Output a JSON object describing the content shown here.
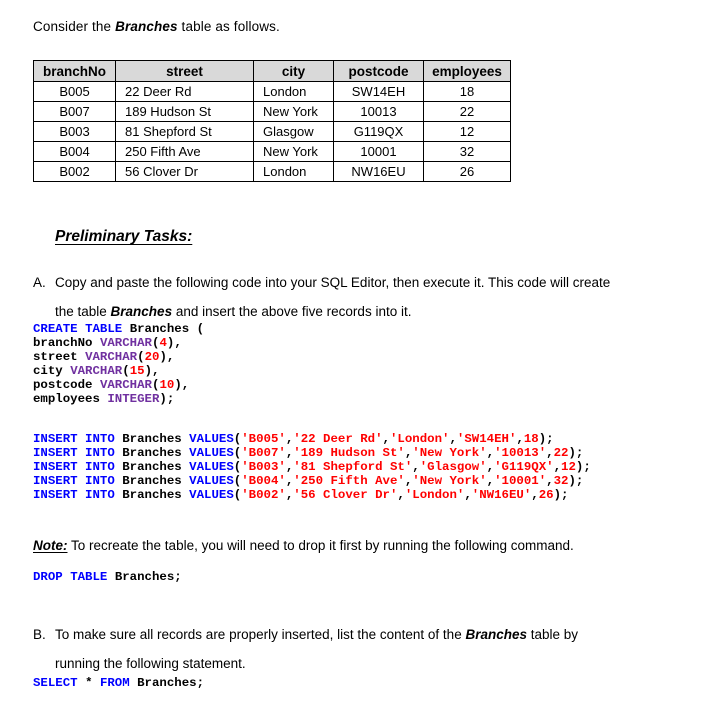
{
  "intro": {
    "before": "Consider the ",
    "emphasis": "Branches",
    "after": " table as follows."
  },
  "branches_table": {
    "columns": [
      "branchNo",
      "street",
      "city",
      "postcode",
      "employees"
    ],
    "rows": [
      [
        "B005",
        "22 Deer Rd",
        "London",
        "SW14EH",
        "18"
      ],
      [
        "B007",
        "189 Hudson St",
        "New York",
        "10013",
        "22"
      ],
      [
        "B003",
        "81 Shepford St",
        "Glasgow",
        "G119QX",
        "12"
      ],
      [
        "B004",
        "250 Fifth Ave",
        "New York",
        "10001",
        "32"
      ],
      [
        "B002",
        "56 Clover Dr",
        "London",
        "NW16EU",
        "26"
      ]
    ],
    "header_fill": "#d9d9d9",
    "border_color": "#000000"
  },
  "section_heading": "Preliminary Tasks:",
  "task_a": {
    "marker": "A.",
    "line1": "Copy and paste the following code into your SQL Editor, then execute it. This code will create",
    "line2_before": "the table ",
    "line2_emphasis": "Branches",
    "line2_after": " and insert the above five records into it."
  },
  "note": {
    "label": "Note:",
    "text": " To recreate the table, you will need to drop it first by running the following command."
  },
  "task_b": {
    "marker": "B.",
    "line1_before": "To make sure all records are properly inserted, list the content of the ",
    "line1_emphasis": "Branches",
    "line1_after": " table by",
    "line2": "running the following statement."
  },
  "code": {
    "colors": {
      "keyword": "#0000ff",
      "type": "#7030a0",
      "literal": "#ff0000",
      "identifier": "#000000"
    },
    "create": {
      "kw_create": "CREATE",
      "kw_table": "TABLE",
      "table_name": "Branches",
      "open_paren": " (",
      "columns": [
        {
          "name": "branchNo",
          "type": "VARCHAR",
          "size": "4",
          "tail": ","
        },
        {
          "name": "street",
          "type": "VARCHAR",
          "size": "20",
          "tail": ","
        },
        {
          "name": "city",
          "type": "VARCHAR",
          "size": "15",
          "tail": ","
        },
        {
          "name": "postcode",
          "type": "VARCHAR",
          "size": "10",
          "tail": ","
        },
        {
          "name": "employees",
          "type": "INTEGER",
          "size": "",
          "tail": ");"
        }
      ]
    },
    "insert": {
      "kw_insert": "INSERT INTO",
      "table_name": "Branches",
      "kw_values": "VALUES",
      "statements": [
        {
          "branchNo": "'B005'",
          "street": "'22 Deer Rd'",
          "city": "'London'",
          "postcode": "'SW14EH'",
          "employees": "18"
        },
        {
          "branchNo": "'B007'",
          "street": "'189 Hudson St'",
          "city": "'New York'",
          "postcode": "'10013'",
          "employees": "22"
        },
        {
          "branchNo": "'B003'",
          "street": "'81 Shepford St'",
          "city": "'Glasgow'",
          "postcode": "'G119QX'",
          "employees": "12"
        },
        {
          "branchNo": "'B004'",
          "street": "'250 Fifth Ave'",
          "city": "'New York'",
          "postcode": "'10001'",
          "employees": "32"
        },
        {
          "branchNo": "'B002'",
          "street": "'56 Clover Dr'",
          "city": "'London'",
          "postcode": "'NW16EU'",
          "employees": "26"
        }
      ]
    },
    "drop": {
      "kw_drop": "DROP",
      "kw_table": "TABLE",
      "table_name": "Branches;"
    },
    "select": {
      "kw_select": "SELECT",
      "star": "*",
      "kw_from": "FROM",
      "table_name": "Branches;"
    }
  }
}
